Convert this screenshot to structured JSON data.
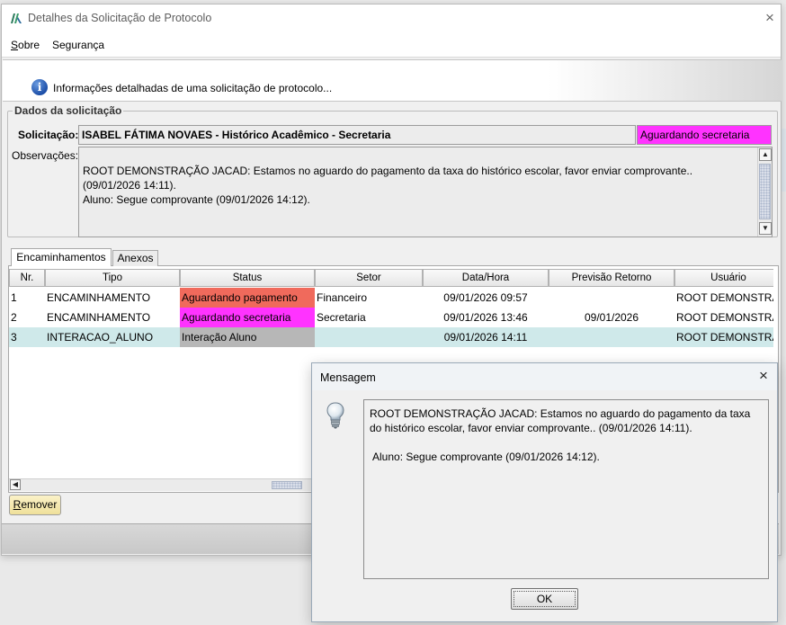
{
  "window": {
    "title": "Detalhes da Solicitação de Protocolo",
    "close_glyph": "×"
  },
  "menu": {
    "items": [
      {
        "label_prefix": "S",
        "label_rest": "obre"
      },
      {
        "label_prefix": "",
        "label_rest": "Segurança"
      }
    ]
  },
  "banner": {
    "icon": "info-icon",
    "text": "Informações detalhadas de uma solicitação de protocolo..."
  },
  "dados": {
    "group_title": "Dados da solicitação",
    "solicitacao_label": "Solicitação:",
    "solicitacao_value": "ISABEL FÁTIMA NOVAES - Histórico Acadêmico - Secretaria",
    "status_value": "Aguardando secretaria",
    "status_color": "#ff33ff",
    "observacoes_label": "Observações:",
    "observacoes_lines": [
      "ROOT DEMONSTRAÇÃO JACAD: Estamos no aguardo do pagamento da taxa do histórico escolar, favor enviar comprovante.. (09/01/2026 14:11).",
      "Aluno: Segue comprovante (09/01/2026 14:12)."
    ]
  },
  "tabs": [
    {
      "label": "Encaminhamentos",
      "active": true
    },
    {
      "label": "Anexos",
      "active": false
    }
  ],
  "table": {
    "columns": [
      "Nr.",
      "Tipo",
      "Status",
      "Setor",
      "Data/Hora",
      "Previsão Retorno",
      "Usuário"
    ],
    "rows": [
      {
        "nr": "1",
        "tipo": "ENCAMINHAMENTO",
        "status": "Aguardando pagamento",
        "status_color": "#f06a5c",
        "setor": "Financeiro",
        "data_hora": "09/01/2026 09:57",
        "previsao": "",
        "usuario": "ROOT DEMONSTRAÇÃO"
      },
      {
        "nr": "2",
        "tipo": "ENCAMINHAMENTO",
        "status": "Aguardando secretaria",
        "status_color": "#ff33ff",
        "setor": "Secretaria",
        "data_hora": "09/01/2026 13:46",
        "previsao": "09/01/2026",
        "usuario": "ROOT DEMONSTRAÇÃO"
      },
      {
        "nr": "3",
        "tipo": "INTERACAO_ALUNO",
        "status": "Interação Aluno",
        "status_color": "#b7b7b7",
        "setor": "",
        "data_hora": "09/01/2026 14:11",
        "previsao": "",
        "usuario": "ROOT DEMONSTRAÇÃO",
        "selected": true
      }
    ],
    "selected_row_color": "#cfe9ea"
  },
  "buttons": {
    "remover_prefix": "R",
    "remover_rest": "emover"
  },
  "dialog": {
    "title": "Mensagem",
    "icon": "lightbulb-icon",
    "message_1": "ROOT DEMONSTRAÇÃO JACAD: Estamos no aguardo do pagamento da taxa do histórico escolar, favor enviar comprovante.. (09/01/2026 14:11).",
    "message_2": "Aluno: Segue comprovante (09/01/2026 14:12).",
    "ok_label": "OK",
    "close_glyph": "×"
  }
}
